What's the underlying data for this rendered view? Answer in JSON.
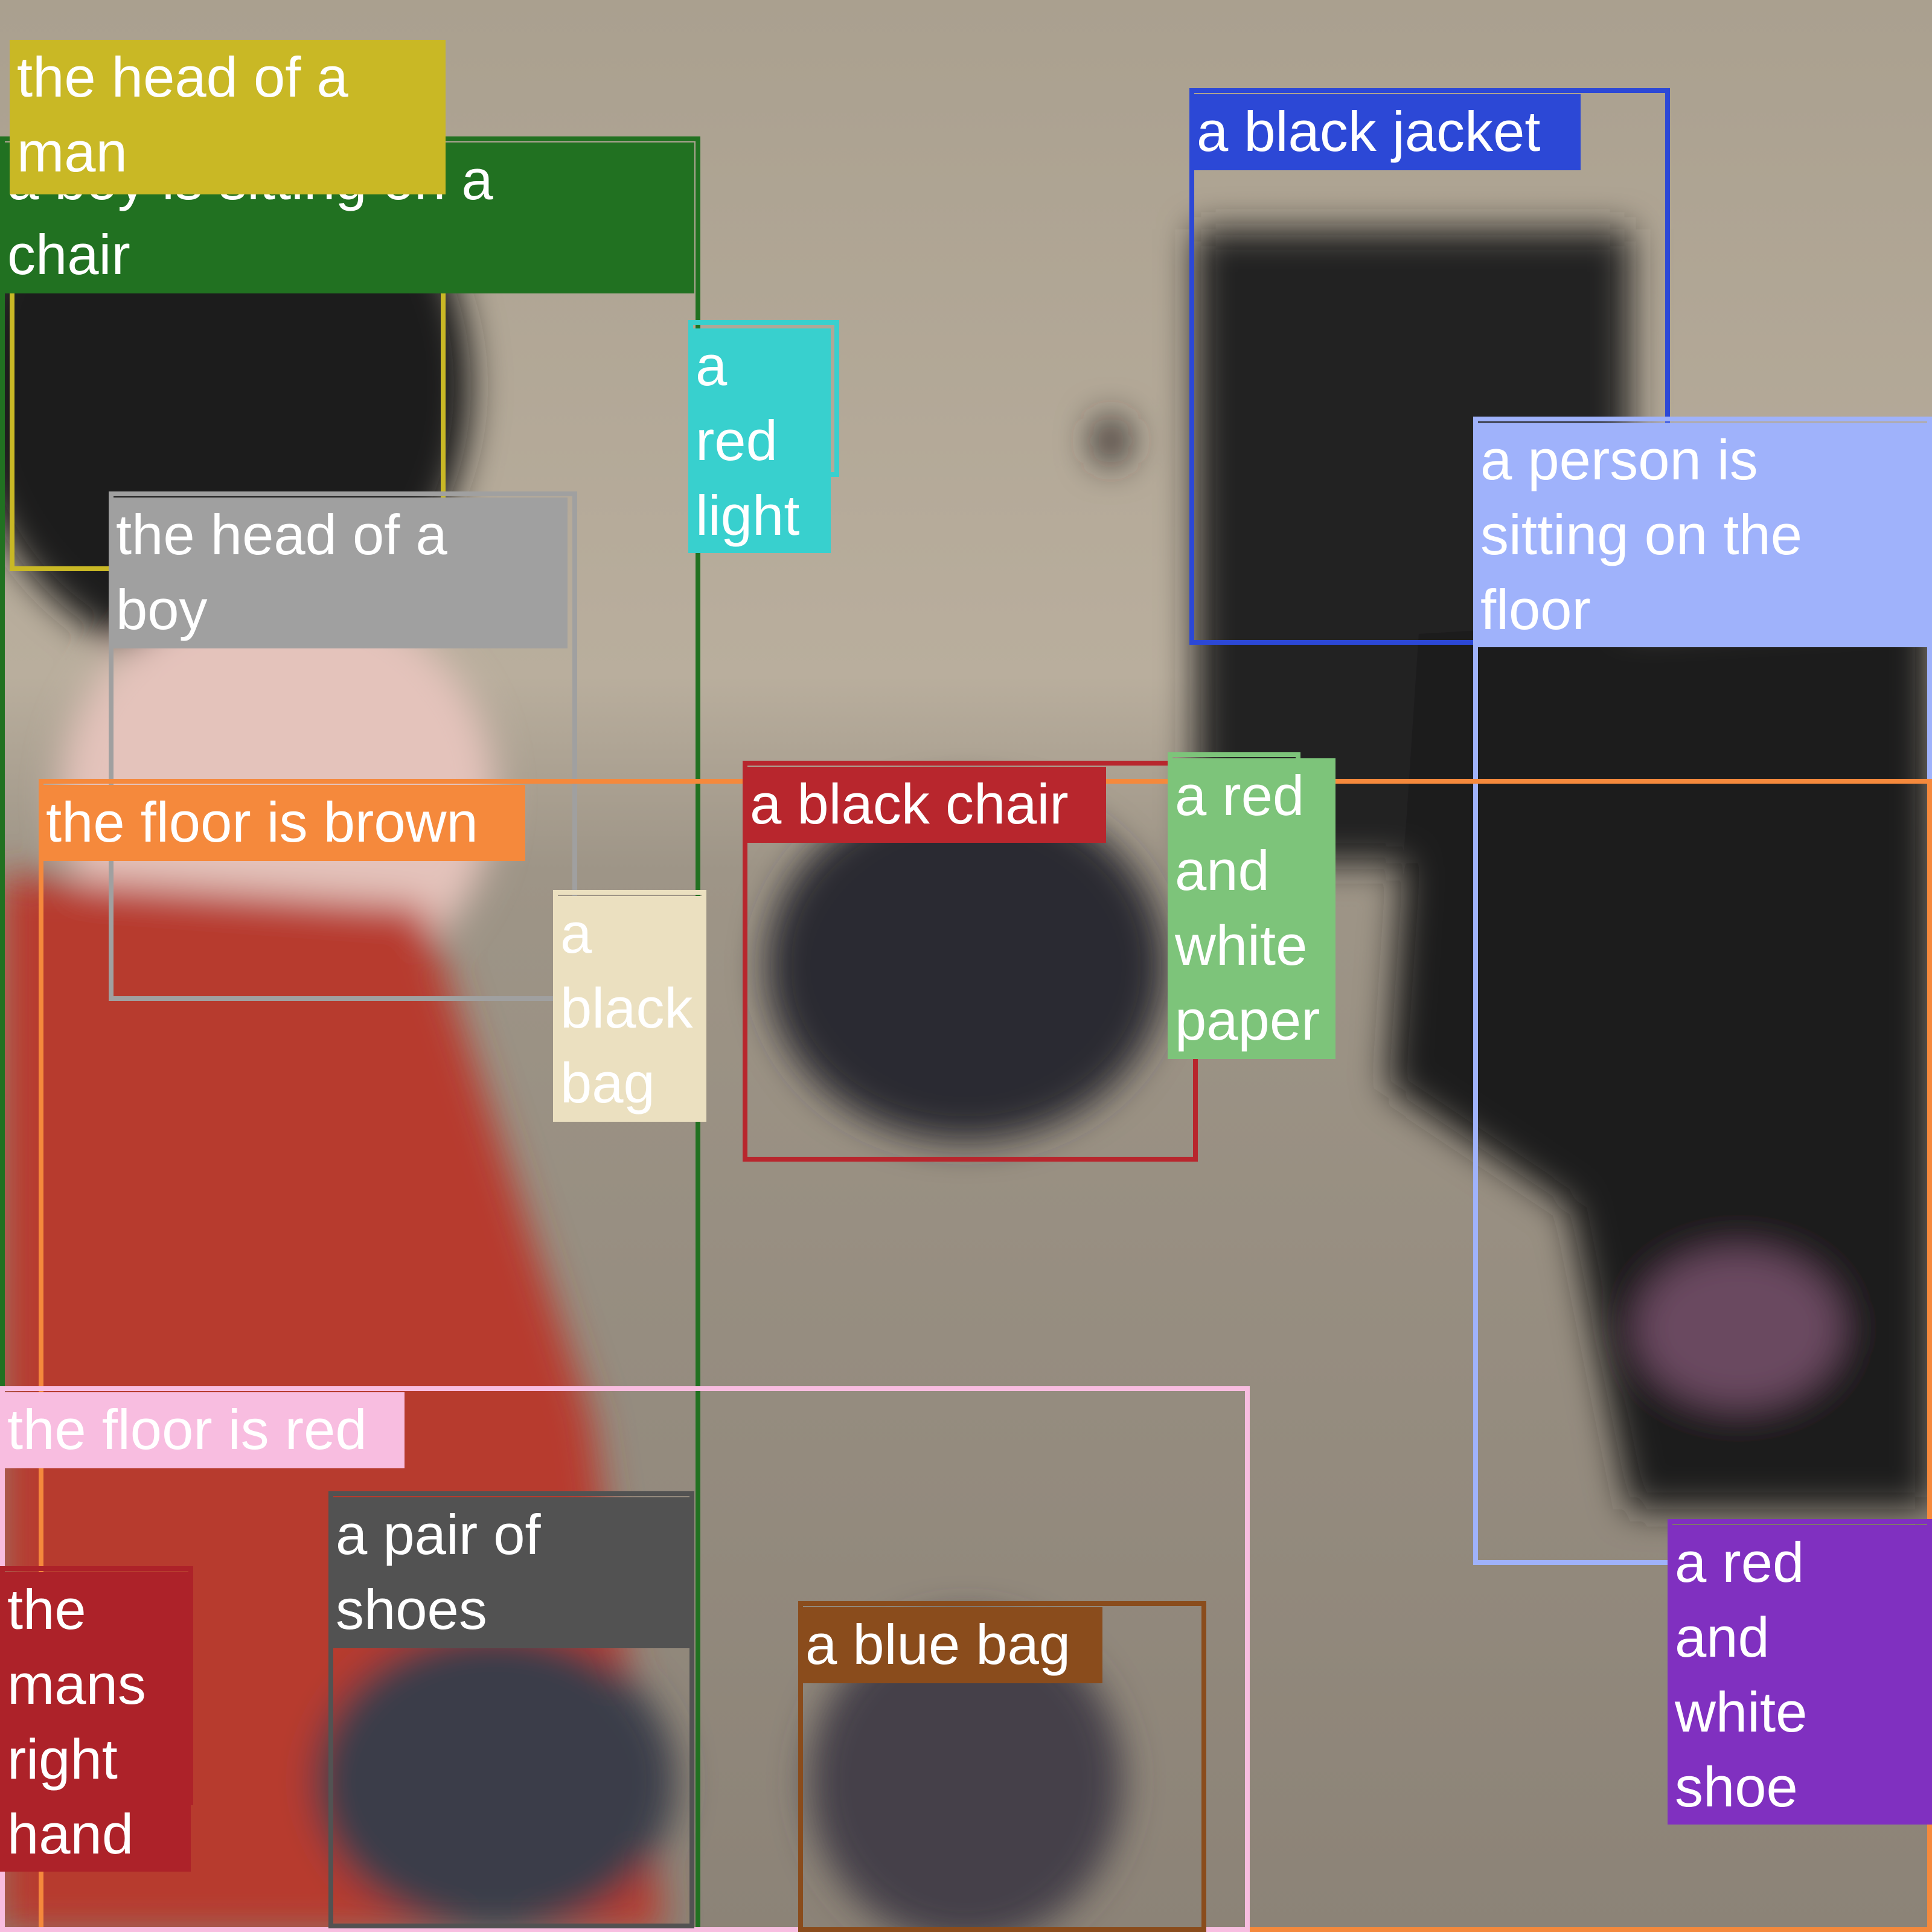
{
  "image": {
    "description_colors": {
      "wall": "#b8ad9c",
      "floor": "#8f8679",
      "shirt": "#b23a2c",
      "dark": "#1f1c1d"
    }
  },
  "annotations": [
    {
      "id": "boy-sitting",
      "label": [
        "a boy is sitting on a",
        "chair"
      ],
      "color": "#217121"
    },
    {
      "id": "head-man",
      "label": [
        "the head of a",
        "man"
      ],
      "color": "#c9b825"
    },
    {
      "id": "black-jacket",
      "label": [
        "a black jacket"
      ],
      "color": "#2c48d6"
    },
    {
      "id": "red-light",
      "label": [
        "a",
        "red",
        "light"
      ],
      "color": "#38d0ce"
    },
    {
      "id": "person-floor",
      "label": [
        "a person is",
        "sitting on the",
        "floor"
      ],
      "color": "#9fb2fb"
    },
    {
      "id": "head-boy",
      "label": [
        "the head of a",
        "boy"
      ],
      "color": "#a0a0a0"
    },
    {
      "id": "floor-brown",
      "label": [
        "the floor is brown"
      ],
      "color": "#f5893c"
    },
    {
      "id": "black-chair",
      "label": [
        "a black chair"
      ],
      "color": "#b8262d"
    },
    {
      "id": "red-white-paper",
      "label": [
        "a red",
        "and",
        "white",
        "paper"
      ],
      "color": "#7dc47a"
    },
    {
      "id": "black-bag",
      "label": [
        "a",
        "black",
        "bag"
      ],
      "color": "#ebe0c0"
    },
    {
      "id": "floor-red",
      "label": [
        "the floor is red"
      ],
      "color": "#f8bde0"
    },
    {
      "id": "pair-shoes",
      "label": [
        "a pair of",
        "shoes"
      ],
      "color": "#525252"
    },
    {
      "id": "mans-hand",
      "label": [
        "the",
        "mans",
        "right",
        "hand"
      ],
      "color": "#ad2229"
    },
    {
      "id": "blue-bag",
      "label": [
        "a blue bag"
      ],
      "color": "#8a4c1c"
    },
    {
      "id": "red-white-shoe",
      "label": [
        "a red",
        "and",
        "white",
        "shoe"
      ],
      "color": "#8030c0"
    }
  ]
}
